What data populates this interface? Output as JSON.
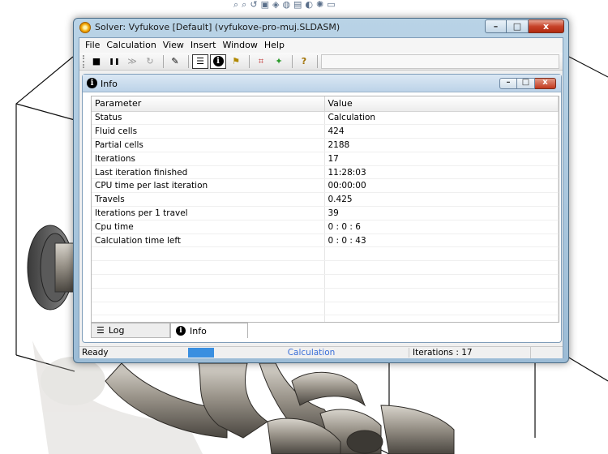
{
  "top_toolbar": {
    "icons": [
      "zoom-icon",
      "zoom-area-icon",
      "rotate-icon",
      "view-icon",
      "section-icon",
      "display-icon",
      "hide-icon",
      "appearance-icon",
      "scene-icon",
      "monitor-icon"
    ]
  },
  "window": {
    "title": "Solver: Vyfukove [Default] (vyfukove-pro-muj.SLDASM)",
    "buttons": {
      "minimize": "–",
      "maximize": "□",
      "close": "x"
    }
  },
  "menu": [
    {
      "id": "file",
      "label": "File"
    },
    {
      "id": "calculation",
      "label": "Calculation"
    },
    {
      "id": "view",
      "label": "View"
    },
    {
      "id": "insert",
      "label": "Insert"
    },
    {
      "id": "window",
      "label": "Window"
    },
    {
      "id": "help",
      "label": "Help"
    }
  ],
  "toolbar": {
    "stop": "■",
    "pause": "❚❚",
    "step": "≫",
    "refresh": "↻",
    "pin": "✎",
    "log": "☰",
    "info": "i",
    "finish": "⚑",
    "plot": "⌗",
    "preview": "✦",
    "help": "?"
  },
  "info_panel": {
    "title": "Info",
    "columns": [
      "Parameter",
      "Value"
    ],
    "rows": [
      [
        "Status",
        "Calculation"
      ],
      [
        "Fluid cells",
        "424"
      ],
      [
        "Partial cells",
        "2188"
      ],
      [
        "Iterations",
        "17"
      ],
      [
        "Last iteration finished",
        "11:28:03"
      ],
      [
        "CPU time per last iteration",
        "00:00:00"
      ],
      [
        "Travels",
        "0.425"
      ],
      [
        "Iterations per 1 travel",
        "39"
      ],
      [
        "Cpu time",
        "0 : 0 : 6"
      ],
      [
        "Calculation time left",
        "0 : 0 : 43"
      ]
    ],
    "empty_rows": 6
  },
  "bottom_tabs": [
    {
      "id": "log",
      "label": "Log",
      "active": false
    },
    {
      "id": "info",
      "label": "Info",
      "active": true
    }
  ],
  "status": {
    "ready": "Ready",
    "progress": 0.3,
    "calculation": "Calculation",
    "iterations": "Iterations : 17"
  },
  "colors": {
    "window_frame": "#a9c6dd",
    "close_button": "#c7432a",
    "progress": "#3a8fe0",
    "status_link": "#3a6fd8"
  }
}
